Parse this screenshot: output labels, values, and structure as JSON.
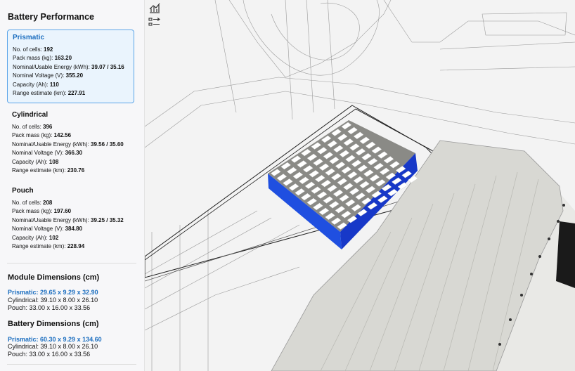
{
  "sidebar": {
    "title": "Battery Performance",
    "cells_label": "No. of cells:",
    "mass_label": "Pack mass (kg):",
    "energy_label": "Nominal/Usable Energy (kWh):",
    "voltage_label": "Nominal Voltage (V):",
    "capacity_label": "Capacity (Ah):",
    "range_label": "Range estimate (km):",
    "options": [
      {
        "name": "Prismatic",
        "cells": "192",
        "mass": "163.20",
        "energy": "39.07 / 35.16",
        "voltage": "355.20",
        "capacity": "110",
        "range": "227.91",
        "selected": true
      },
      {
        "name": "Cylindrical",
        "cells": "396",
        "mass": "142.56",
        "energy": "39.56 / 35.60",
        "voltage": "366.30",
        "capacity": "108",
        "range": "230.76",
        "selected": false
      },
      {
        "name": "Pouch",
        "cells": "208",
        "mass": "197.60",
        "energy": "39.25 / 35.32",
        "voltage": "384.80",
        "capacity": "102",
        "range": "228.94",
        "selected": false
      }
    ]
  },
  "module_dimensions": {
    "title": "Module Dimensions (cm)",
    "prismatic": "Prismatic: 29.65 x 9.29 x 32.90",
    "cylindrical": "Cylindrical: 39.10 x 8.00 x 26.10",
    "pouch": "Pouch: 33.00 x 16.00 x 33.56"
  },
  "battery_dimensions": {
    "title": "Battery Dimensions (cm)",
    "prismatic": "Prismatic: 60.30 x 9.29 x 134.60",
    "cylindrical": "Cylindrical: 39.10 x 8.00 x 26.10",
    "pouch": "Pouch: 33.00 x 16.00 x 33.56"
  },
  "viewport": {
    "tools": [
      {
        "icon": "chart-icon"
      },
      {
        "icon": "layers-toggle-icon"
      }
    ],
    "pack_color": "#1f4fe0"
  }
}
